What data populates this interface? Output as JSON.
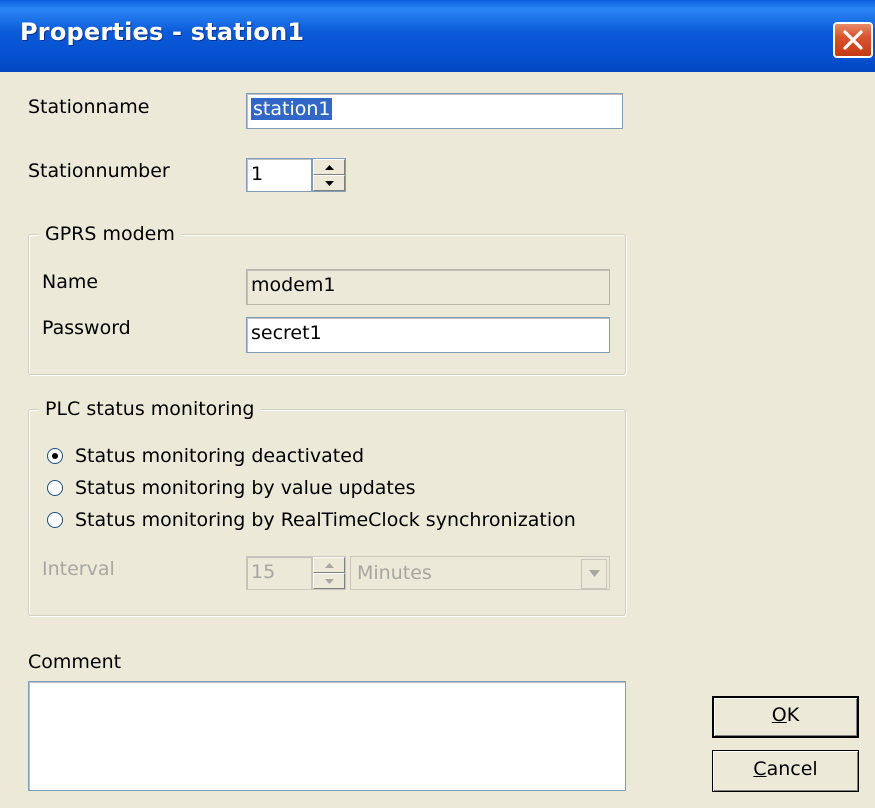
{
  "window": {
    "title": "Properties - station1"
  },
  "station": {
    "name_label": "Stationname",
    "name_value": "station1",
    "number_label": "Stationnumber",
    "number_value": "1"
  },
  "gprs": {
    "group_title": "GPRS modem",
    "name_label": "Name",
    "name_value": "modem1",
    "password_label": "Password",
    "password_value": "secret1"
  },
  "plc": {
    "group_title": "PLC status monitoring",
    "options": [
      {
        "label": "Status monitoring deactivated",
        "checked": true
      },
      {
        "label": "Status monitoring by value updates",
        "checked": false
      },
      {
        "label": "Status monitoring by RealTimeClock synchronization",
        "checked": false
      }
    ],
    "interval_label": "Interval",
    "interval_value": "15",
    "interval_unit": "Minutes"
  },
  "comment": {
    "label": "Comment",
    "value": ""
  },
  "buttons": {
    "ok_mnemonic": "O",
    "ok_rest": "K",
    "cancel_mnemonic": "C",
    "cancel_rest": "ancel"
  },
  "icons": {
    "close": "close-icon",
    "spin_up": "arrow-up-icon",
    "spin_down": "arrow-down-icon",
    "dropdown": "chevron-down-icon"
  },
  "colors": {
    "titlebar": "#0550d0",
    "dialog_bg": "#ece9d8",
    "selection": "#3167c6",
    "close_button": "#d9542e"
  }
}
